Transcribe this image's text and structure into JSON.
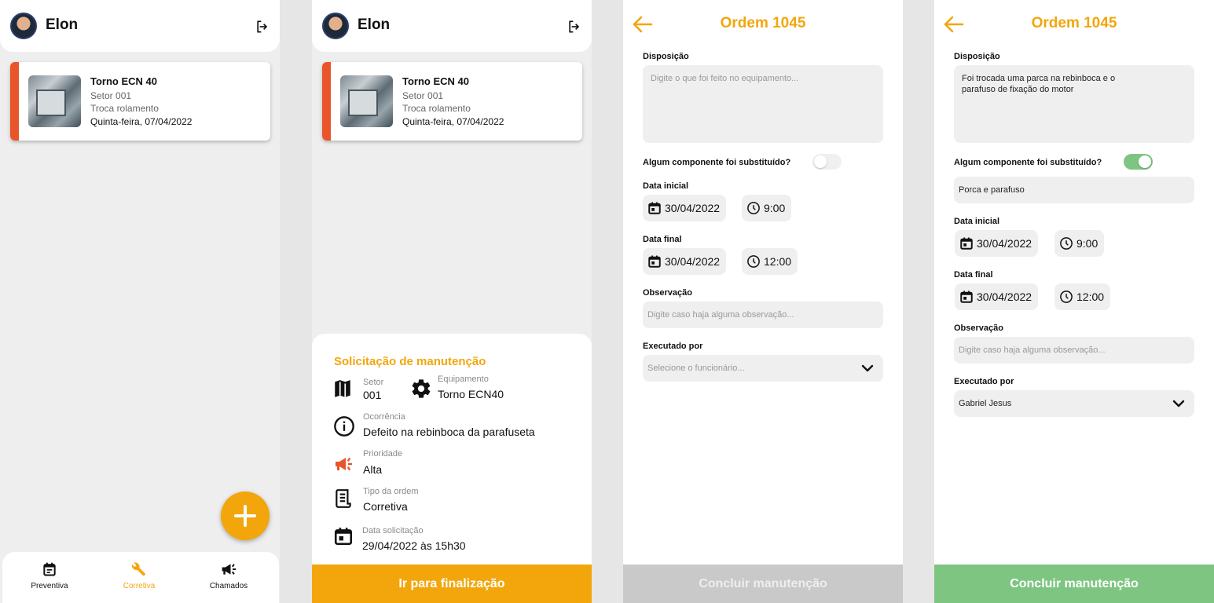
{
  "user": {
    "name": "Elon"
  },
  "order_card": {
    "title": "Torno ECN 40",
    "sector": "Setor 001",
    "task": "Troca rolamento",
    "date": "Quinta-feira, 07/04/2022"
  },
  "bottom_nav": {
    "items": [
      {
        "label": "Preventiva",
        "icon": "calendar-icon",
        "active": false
      },
      {
        "label": "Corretiva",
        "icon": "wrench-icon",
        "active": true
      },
      {
        "label": "Chamados",
        "icon": "megaphone-icon",
        "active": false
      }
    ]
  },
  "request_sheet": {
    "title": "Solicitação de manutenção",
    "sector_label": "Setor",
    "sector_value": "001",
    "equipment_label": "Equipamento",
    "equipment_value": "Torno ECN40",
    "occurrence_label": "Ocorrência",
    "occurrence_value": "Defeito na rebinboca da parafuseta",
    "priority_label": "Prioridade",
    "priority_value": "Alta",
    "order_type_label": "Tipo da ordem",
    "order_type_value": "Corretiva",
    "request_date_label": "Data solicitação",
    "request_date_value": "29/04/2022 às 15h30",
    "action_button": "Ir para finalização"
  },
  "form_empty": {
    "title": "Ordem 1045",
    "disposition_label": "Disposição",
    "disposition_placeholder": "Digite o que foi feito no equipamento...",
    "component_question": "Algum componente foi substituído?",
    "component_replaced": false,
    "start_label": "Data inicial",
    "start_date": "30/04/2022",
    "start_time": "9:00",
    "end_label": "Data final",
    "end_date": "30/04/2022",
    "end_time": "12:00",
    "observation_label": "Observação",
    "observation_placeholder": "Digite caso haja alguma observação...",
    "executed_by_label": "Executado por",
    "executed_by_placeholder": "Selecione o funcionário...",
    "submit_button": "Concluir manutenção"
  },
  "form_filled": {
    "title": "Ordem 1045",
    "disposition_label": "Disposição",
    "disposition_value": "Foi trocada uma parca na rebinboca e o parafuso de fixação do motor",
    "component_question": "Algum componente foi substituído?",
    "component_replaced": true,
    "component_value": "Porca e parafuso",
    "start_label": "Data inicial",
    "start_date": "30/04/2022",
    "start_time": "9:00",
    "end_label": "Data final",
    "end_date": "30/04/2022",
    "end_time": "12:00",
    "observation_label": "Observação",
    "observation_placeholder": "Digite caso haja alguma observação...",
    "executed_by_label": "Executado por",
    "executed_by_value": "Gabriel Jesus",
    "submit_button": "Concluir manutenção"
  },
  "colors": {
    "accent": "#f2a60c",
    "stripe": "#e8552a",
    "success": "#7ec582",
    "disabled": "#c9c9c9"
  }
}
